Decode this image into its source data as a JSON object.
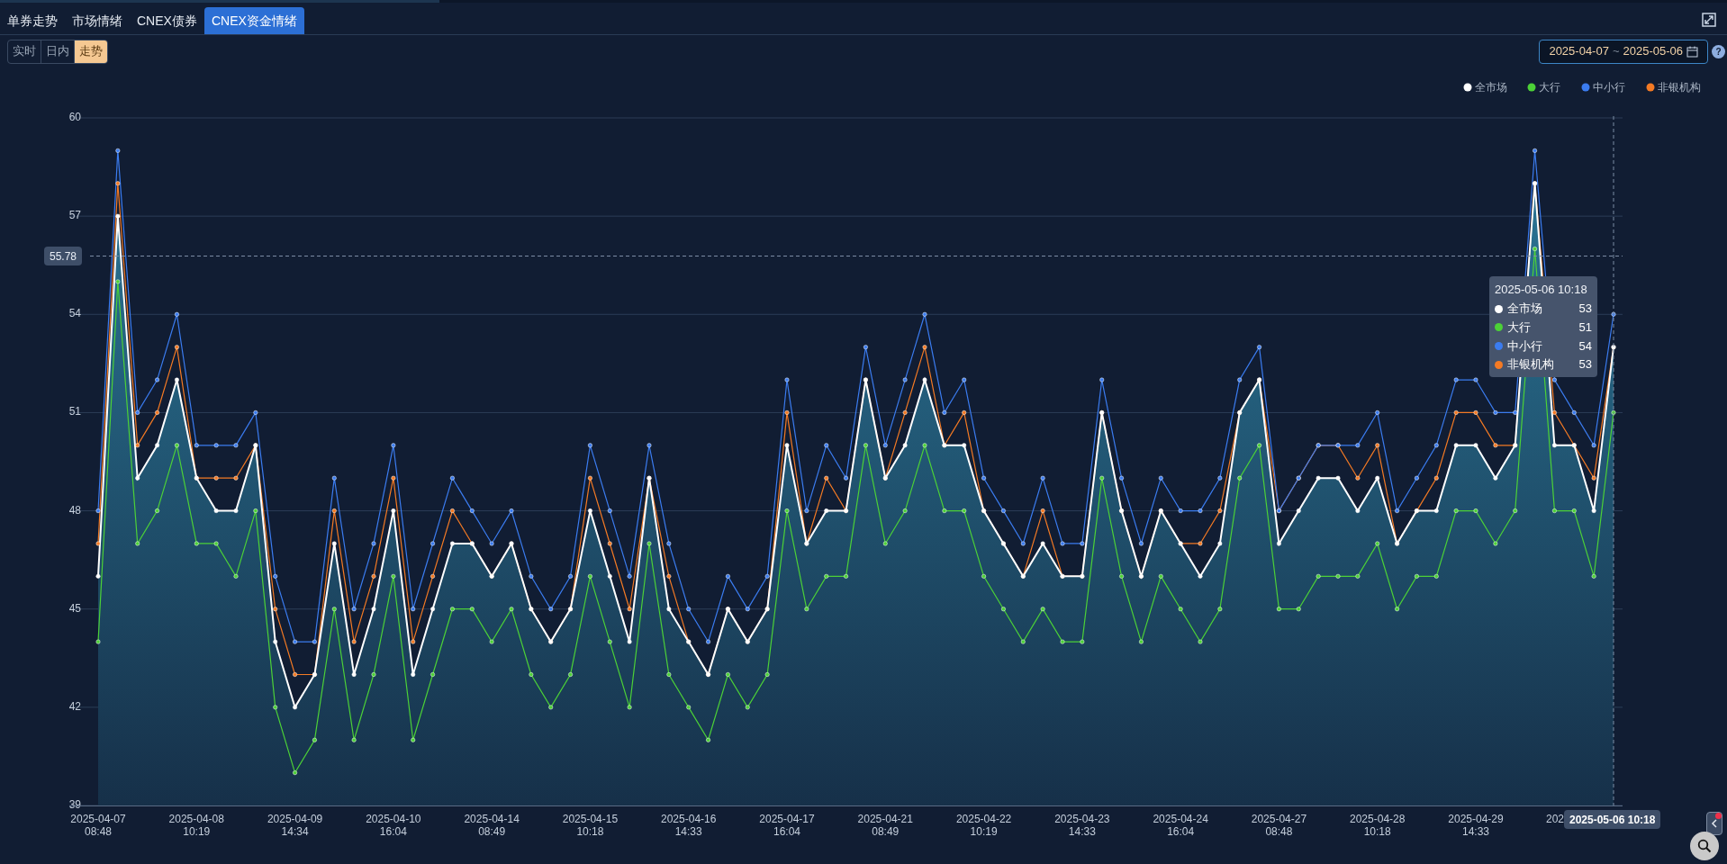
{
  "tabs": [
    {
      "label": "单券走势",
      "selected": false
    },
    {
      "label": "市场情绪",
      "selected": false
    },
    {
      "label": "CNEX债券",
      "selected": false
    },
    {
      "label": "CNEX资金情绪",
      "selected": true
    }
  ],
  "modes": [
    {
      "label": "实时",
      "selected": false
    },
    {
      "label": "日内",
      "selected": false
    },
    {
      "label": "走势",
      "selected": true
    }
  ],
  "date_range": {
    "start": "2025-04-07",
    "separator": "~",
    "end": "2025-05-06"
  },
  "help": "?",
  "chart": {
    "chart_data": {
      "type": "line",
      "categories": [
        "2025-04-07\n08:48",
        null,
        null,
        null,
        null,
        "2025-04-08\n10:19",
        null,
        null,
        null,
        null,
        "2025-04-09\n14:34",
        null,
        null,
        null,
        null,
        "2025-04-10\n16:04",
        null,
        null,
        null,
        null,
        "2025-04-14\n08:49",
        null,
        null,
        null,
        null,
        "2025-04-15\n10:18",
        null,
        null,
        null,
        null,
        "2025-04-16\n14:33",
        null,
        null,
        null,
        null,
        "2025-04-17\n16:04",
        null,
        null,
        null,
        null,
        "2025-04-21\n08:49",
        null,
        null,
        null,
        null,
        "2025-04-22\n10:19",
        null,
        null,
        null,
        null,
        "2025-04-23\n14:33",
        null,
        null,
        null,
        null,
        "2025-04-24\n16:04",
        null,
        null,
        null,
        null,
        "2025-04-27\n08:48",
        null,
        null,
        null,
        null,
        "2025-04-28\n10:18",
        null,
        null,
        null,
        null,
        "2025-04-29\n14:33",
        null,
        null,
        null,
        null,
        null,
        null,
        null
      ],
      "legend": true,
      "ref_lines": [
        {
          "axis": "y",
          "value": 55.78,
          "label": "55.78"
        }
      ],
      "grid": true,
      "ylim": [
        39,
        60
      ],
      "yticks": [
        39,
        42,
        45,
        48,
        51,
        54,
        57,
        60
      ],
      "series": [
        {
          "name": "全市场",
          "color": "#ffffff",
          "type": "area",
          "marker": "circle",
          "values": [
            46,
            57,
            49,
            50,
            52,
            49,
            48,
            48,
            50,
            44,
            42,
            43,
            47,
            43,
            45,
            48,
            43,
            45,
            47,
            47,
            46,
            47,
            45,
            44,
            45,
            48,
            46,
            44,
            49,
            45,
            44,
            43,
            45,
            44,
            45,
            50,
            47,
            48,
            48,
            52,
            49,
            50,
            52,
            50,
            50,
            48,
            47,
            46,
            47,
            46,
            46,
            51,
            48,
            46,
            48,
            47,
            46,
            47,
            51,
            52,
            47,
            48,
            49,
            49,
            48,
            49,
            47,
            48,
            48,
            50,
            50,
            49,
            50,
            58,
            50,
            50,
            48,
            53
          ]
        },
        {
          "name": "大行",
          "color": "#4cd137",
          "marker": "circle",
          "values": [
            44,
            55,
            47,
            48,
            50,
            47,
            47,
            46,
            48,
            42,
            40,
            41,
            45,
            41,
            43,
            46,
            41,
            43,
            45,
            45,
            44,
            45,
            43,
            42,
            43,
            46,
            44,
            42,
            47,
            43,
            42,
            41,
            43,
            42,
            43,
            48,
            45,
            46,
            46,
            50,
            47,
            48,
            50,
            48,
            48,
            46,
            45,
            44,
            45,
            44,
            44,
            49,
            46,
            44,
            46,
            45,
            44,
            45,
            49,
            50,
            45,
            45,
            46,
            46,
            46,
            47,
            45,
            46,
            46,
            48,
            48,
            47,
            48,
            56,
            48,
            48,
            46,
            51
          ]
        },
        {
          "name": "中小行",
          "color": "#3b7cf0",
          "marker": "circle",
          "values": [
            48,
            59,
            51,
            52,
            54,
            50,
            50,
            50,
            51,
            46,
            44,
            44,
            49,
            45,
            47,
            50,
            45,
            47,
            49,
            48,
            47,
            48,
            46,
            45,
            46,
            50,
            48,
            46,
            50,
            47,
            45,
            44,
            46,
            45,
            46,
            52,
            48,
            50,
            49,
            53,
            50,
            52,
            54,
            51,
            52,
            49,
            48,
            47,
            49,
            47,
            47,
            52,
            49,
            47,
            49,
            48,
            48,
            49,
            52,
            53,
            48,
            49,
            50,
            50,
            50,
            51,
            48,
            49,
            50,
            52,
            52,
            51,
            51,
            59,
            52,
            51,
            50,
            54
          ]
        },
        {
          "name": "非银机构",
          "color": "#f47a24",
          "marker": "circle",
          "values": [
            47,
            58,
            50,
            51,
            53,
            49,
            49,
            49,
            50,
            45,
            43,
            43,
            48,
            44,
            46,
            49,
            44,
            46,
            48,
            47,
            46,
            47,
            45,
            44,
            45,
            49,
            47,
            45,
            49,
            46,
            44,
            43,
            45,
            44,
            45,
            51,
            47,
            49,
            48,
            52,
            49,
            51,
            53,
            50,
            51,
            48,
            47,
            46,
            48,
            46,
            46,
            51,
            48,
            46,
            48,
            47,
            47,
            48,
            51,
            52,
            48,
            49,
            50,
            50,
            49,
            50,
            47,
            48,
            49,
            51,
            51,
            50,
            50,
            58,
            51,
            50,
            49,
            53
          ]
        }
      ]
    },
    "crosshair": {
      "x_label": "2025-05-06 10:18",
      "covered_tick_label": "202"
    },
    "tooltip": {
      "title": "2025-05-06 10:18",
      "rows": [
        {
          "label": "全市场",
          "value": "53",
          "color": "#ffffff"
        },
        {
          "label": "大行",
          "value": "51",
          "color": "#4cd137"
        },
        {
          "label": "中小行",
          "value": "54",
          "color": "#3b7cf0"
        },
        {
          "label": "非银机构",
          "value": "53",
          "color": "#f47a24"
        }
      ]
    }
  }
}
